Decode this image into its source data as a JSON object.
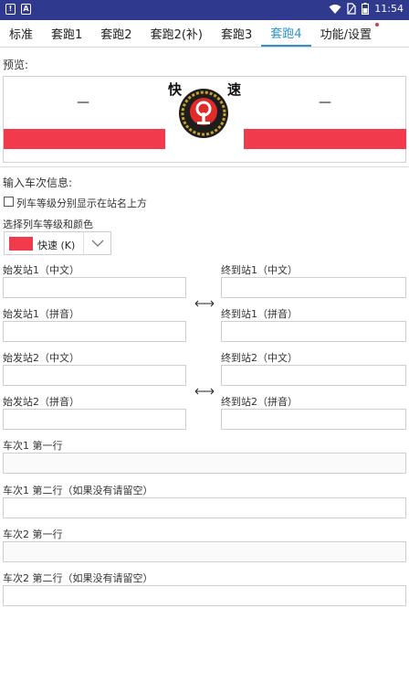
{
  "status_bar": {
    "time": "11:54"
  },
  "tabs": [
    {
      "label": "标准"
    },
    {
      "label": "套跑1"
    },
    {
      "label": "套跑2"
    },
    {
      "label": "套跑2(补)"
    },
    {
      "label": "套跑3"
    },
    {
      "label": "套跑4",
      "active": true
    },
    {
      "label": "功能/设置"
    }
  ],
  "preview": {
    "title": "预览:",
    "char_left": "快",
    "char_right": "速",
    "dash_left": "—",
    "dash_right": "—",
    "bar_color": "#f23a4d"
  },
  "form": {
    "section_title": "输入车次信息:",
    "checkbox_label": "列车等级分别显示在站名上方",
    "checkbox_checked": false,
    "grade_label": "选择列车等级和颜色",
    "grade_value": "快速 (K)",
    "grade_color": "#f23a4d",
    "start1_cn": "始发站1（中文）",
    "end1_cn": "终到站1（中文）",
    "start1_py": "始发站1（拼音）",
    "end1_py": "终到站1（拼音）",
    "start2_cn": "始发站2（中文）",
    "end2_cn": "终到站2（中文）",
    "start2_py": "始发站2（拼音）",
    "end2_py": "终到站2（拼音）",
    "train1_line1": "车次1 第一行",
    "train1_line2": "车次1 第二行（如果没有请留空）",
    "train2_line1": "车次2 第一行",
    "train2_line2": "车次2 第二行（如果没有请留空）"
  },
  "colors": {
    "accent": "#2e94c9",
    "status_bar": "#2f3a8f"
  }
}
